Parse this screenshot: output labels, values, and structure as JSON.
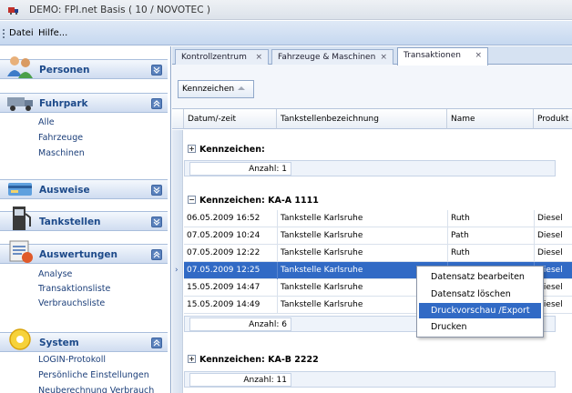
{
  "window": {
    "title": "DEMO: FPI.net Basis ( 10 / NOVOTEC )",
    "icon": "app-truck-icon"
  },
  "menu": {
    "items": [
      "Datei",
      "Hilfe..."
    ]
  },
  "sidebar": {
    "sections": [
      {
        "title": "Personen",
        "icon": "people-icon",
        "expanded": false,
        "links": []
      },
      {
        "title": "Fuhrpark",
        "icon": "truck-icon",
        "expanded": true,
        "links": [
          "Alle",
          "Fahrzeuge",
          "Maschinen"
        ]
      },
      {
        "title": "Ausweise",
        "icon": "card-icon",
        "expanded": false,
        "links": []
      },
      {
        "title": "Tankstellen",
        "icon": "fuel-pump-icon",
        "expanded": false,
        "links": []
      },
      {
        "title": "Auswertungen",
        "icon": "report-icon",
        "expanded": true,
        "links": [
          "Analyse",
          "Transaktionsliste",
          "Verbrauchsliste"
        ]
      },
      {
        "title": "System",
        "icon": "system-icon",
        "expanded": true,
        "links": [
          "LOGIN-Protokoll",
          "Persönliche Einstellungen",
          "Neuberechnung Verbrauch"
        ]
      }
    ]
  },
  "tabs": [
    {
      "label": "Kontrollzentrum",
      "close": "×",
      "active": false
    },
    {
      "label": "Fahrzeuge & Maschinen",
      "close": "×",
      "active": false
    },
    {
      "label": "Transaktionen",
      "close": "×",
      "active": true
    }
  ],
  "grouping": {
    "chip": "Kennzeichen"
  },
  "grid": {
    "columns": [
      "Datum/-zeit",
      "Tankstellenbezeichnung",
      "Name",
      "Produkt"
    ],
    "groups": [
      {
        "header": "Kennzeichen:",
        "expanded": false,
        "count_label": "Anzahl: 1",
        "rows": []
      },
      {
        "header": "Kennzeichen: KA-A 1111",
        "expanded": true,
        "count_label": "Anzahl: 6",
        "rows": [
          {
            "datum": "06.05.2009 16:52",
            "tankstelle": "Tankstelle Karlsruhe",
            "name": "Ruth",
            "produkt": "Diesel"
          },
          {
            "datum": "07.05.2009 10:24",
            "tankstelle": "Tankstelle Karlsruhe",
            "name": "Path",
            "produkt": "Diesel"
          },
          {
            "datum": "07.05.2009 12:22",
            "tankstelle": "Tankstelle Karlsruhe",
            "name": "Ruth",
            "produkt": "Diesel"
          },
          {
            "datum": "07.05.2009 12:25",
            "tankstelle": "Tankstelle Karlsruhe",
            "name": "",
            "produkt": "Diesel",
            "selected": true
          },
          {
            "datum": "15.05.2009 14:47",
            "tankstelle": "Tankstelle Karlsruhe",
            "name": "",
            "produkt": "Diesel"
          },
          {
            "datum": "15.05.2009 14:49",
            "tankstelle": "Tankstelle Karlsruhe",
            "name": "",
            "produkt": "Diesel"
          }
        ]
      },
      {
        "header": "Kennzeichen: KA-B 2222",
        "expanded": false,
        "count_label": "Anzahl: 11",
        "rows": []
      }
    ]
  },
  "context_menu": {
    "items": [
      {
        "label": "Datensatz bearbeiten",
        "highlighted": false
      },
      {
        "label": "Datensatz löschen",
        "highlighted": false
      },
      {
        "label": "Druckvorschau /Export",
        "highlighted": true
      },
      {
        "label": "Drucken",
        "highlighted": false
      }
    ]
  },
  "colors": {
    "accent": "#316ac5",
    "header_text": "#1d4a8a"
  }
}
